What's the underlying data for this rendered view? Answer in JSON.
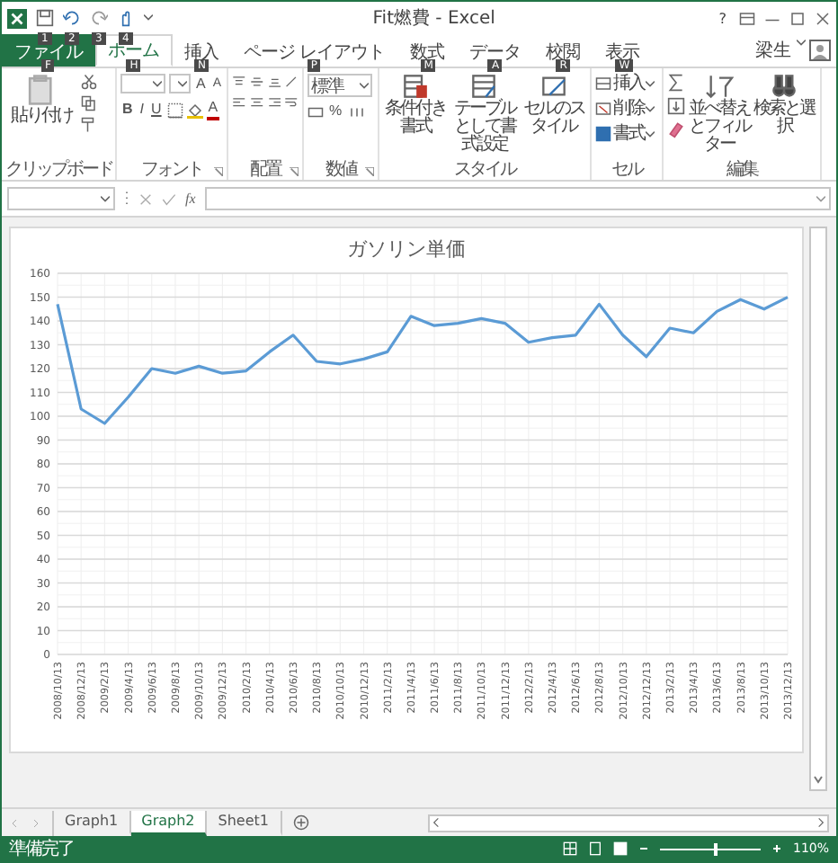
{
  "window": {
    "title": "Fit燃費 - Excel",
    "help": "?",
    "user": "梁生"
  },
  "quick_access": [
    {
      "kind": "save",
      "keytip": "1"
    },
    {
      "kind": "undo",
      "keytip": "2"
    },
    {
      "kind": "redo",
      "keytip": "3"
    },
    {
      "kind": "touch",
      "keytip": "4"
    }
  ],
  "tabs": [
    {
      "label": "ファイル",
      "keytip": "F",
      "kind": "file",
      "selected": false
    },
    {
      "label": "ホーム",
      "keytip": "H",
      "kind": "normal",
      "selected": true
    },
    {
      "label": "挿入",
      "keytip": "N",
      "kind": "normal",
      "selected": false
    },
    {
      "label": "ページ レイアウト",
      "keytip": "P",
      "kind": "normal",
      "selected": false
    },
    {
      "label": "数式",
      "keytip": "M",
      "kind": "normal",
      "selected": false
    },
    {
      "label": "データ",
      "keytip": "A",
      "kind": "normal",
      "selected": false
    },
    {
      "label": "校閲",
      "keytip": "R",
      "kind": "normal",
      "selected": false
    },
    {
      "label": "表示",
      "keytip": "W",
      "kind": "normal",
      "selected": false
    }
  ],
  "ribbon": {
    "clipboard": {
      "label": "クリップボード",
      "paste": "貼り付け"
    },
    "font": {
      "label": "フォント",
      "grow": "A",
      "shrink": "A",
      "bold": "B",
      "italic": "I",
      "underline": "U",
      "text_colour_glyph": "A"
    },
    "alignment": {
      "label": "配置"
    },
    "number": {
      "label": "数値",
      "format": "標準",
      "percent": "%"
    },
    "styles": {
      "label": "スタイル",
      "buttons": [
        "条件付き書式",
        "テーブルとして書式設定",
        "セルのスタイル"
      ]
    },
    "cells": {
      "label": "セル",
      "buttons": [
        {
          "label": "挿入",
          "kind": "insert"
        },
        {
          "label": "削除",
          "kind": "delete"
        },
        {
          "label": "書式",
          "kind": "format"
        }
      ]
    },
    "editing": {
      "label": "編集",
      "buttons": [
        {
          "label": "並べ替えとフィルター",
          "kind": "sort"
        },
        {
          "label": "検索と選択",
          "kind": "find"
        }
      ]
    }
  },
  "formula_bar": {
    "fx": "fx"
  },
  "chart_data": {
    "type": "line",
    "title": "ガソリン単価",
    "categories": [
      "2008/10/13",
      "2008/12/13",
      "2009/2/13",
      "2009/4/13",
      "2009/6/13",
      "2009/8/13",
      "2009/10/13",
      "2009/12/13",
      "2010/2/13",
      "2010/4/13",
      "2010/6/13",
      "2010/8/13",
      "2010/10/13",
      "2010/12/13",
      "2011/2/13",
      "2011/4/13",
      "2011/6/13",
      "2011/8/13",
      "2011/10/13",
      "2011/12/13",
      "2012/2/13",
      "2012/4/13",
      "2012/6/13",
      "2012/8/13",
      "2012/10/13",
      "2012/12/13",
      "2013/2/13",
      "2013/4/13",
      "2013/6/13",
      "2013/8/13",
      "2013/10/13",
      "2013/12/13"
    ],
    "grid": true,
    "series": [
      {
        "color": "#5b9bd5",
        "values": [
          147,
          103,
          97,
          108,
          120,
          118,
          121,
          118,
          119,
          127,
          134,
          123,
          122,
          124,
          127,
          142,
          138,
          139,
          141,
          139,
          131,
          133,
          134,
          147,
          134,
          125,
          137,
          135,
          144,
          149,
          145,
          150
        ]
      }
    ],
    "ylim": [
      0,
      160
    ],
    "yticks": [
      0,
      10,
      20,
      30,
      40,
      50,
      60,
      70,
      80,
      90,
      100,
      110,
      120,
      130,
      140,
      150,
      160
    ]
  },
  "sheet_tabs": [
    {
      "label": "Graph1",
      "selected": false
    },
    {
      "label": "Graph2",
      "selected": true
    },
    {
      "label": "Sheet1",
      "selected": false
    }
  ],
  "status_bar": {
    "text": "準備完了",
    "zoom": "110%",
    "level": 0.55
  }
}
